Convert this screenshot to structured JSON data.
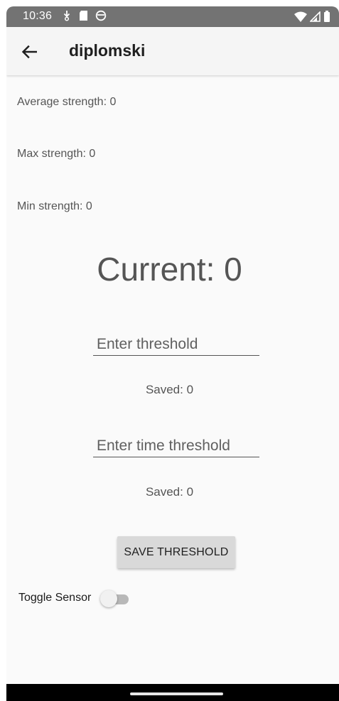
{
  "status_bar": {
    "time": "10:36",
    "left_icons": [
      "download-icon",
      "sd-card-icon",
      "sync-icon"
    ],
    "right_icons": [
      "wifi-icon",
      "signal-icon",
      "battery-icon"
    ]
  },
  "app_bar": {
    "back_icon": "arrow-left-icon",
    "title": "diplomski"
  },
  "stats": {
    "average": "Average strength: 0",
    "max": "Max strength: 0",
    "min": "Min strength: 0"
  },
  "current": "Current: 0",
  "threshold_field": {
    "value": "",
    "placeholder": "Enter threshold"
  },
  "threshold_saved": "Saved: 0",
  "time_threshold_field": {
    "value": "",
    "placeholder": "Enter time threshold"
  },
  "time_threshold_saved": "Saved: 0",
  "save_button_label": "SAVE THRESHOLD",
  "toggle": {
    "label": "Toggle Sensor",
    "checked": false
  },
  "colors": {
    "status_bar": "#737373",
    "app_bar": "#f5f5f5",
    "background": "#fafafa",
    "text_secondary": "#555555",
    "button": "#d9d9d9",
    "switch_track": "#b8b8b8",
    "nav_bar": "#000000"
  }
}
